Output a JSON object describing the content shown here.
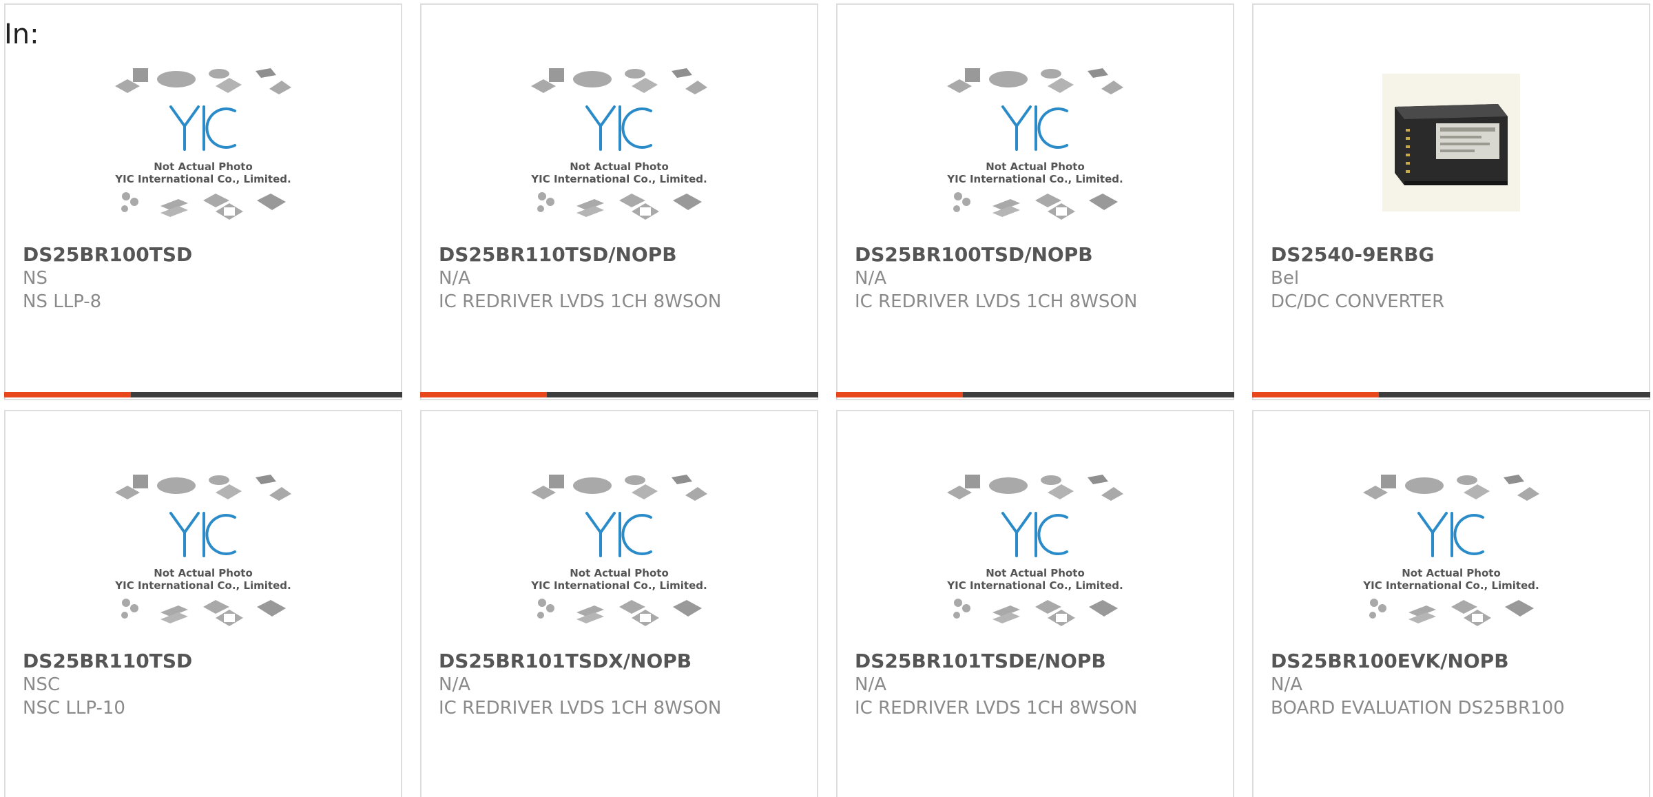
{
  "header": {
    "label": "In:"
  },
  "placeholder": {
    "logo_text": "YIC",
    "line1": "Not Actual Photo",
    "line2": "YIC International Co., Limited."
  },
  "colors": {
    "accent": "#e8461b",
    "bar": "#3d3d3d",
    "logo_blue": "#2a8bc8"
  },
  "products": [
    {
      "part": "DS25BR100TSD",
      "manufacturer": "NS",
      "description": "NS LLP-8",
      "image": "placeholder"
    },
    {
      "part": "DS25BR110TSD/NOPB",
      "manufacturer": "N/A",
      "description": "IC REDRIVER LVDS 1CH 8WSON",
      "image": "placeholder"
    },
    {
      "part": "DS25BR100TSD/NOPB",
      "manufacturer": "N/A",
      "description": "IC REDRIVER LVDS 1CH 8WSON",
      "image": "placeholder"
    },
    {
      "part": "DS2540-9ERBG",
      "manufacturer": "Bel",
      "description": "DC/DC CONVERTER",
      "image": "product-photo"
    },
    {
      "part": "DS25BR110TSD",
      "manufacturer": "NSC",
      "description": "NSC LLP-10",
      "image": "placeholder"
    },
    {
      "part": "DS25BR101TSDX/NOPB",
      "manufacturer": "N/A",
      "description": "IC REDRIVER LVDS 1CH 8WSON",
      "image": "placeholder"
    },
    {
      "part": "DS25BR101TSDE/NOPB",
      "manufacturer": "N/A",
      "description": "IC REDRIVER LVDS 1CH 8WSON",
      "image": "placeholder"
    },
    {
      "part": "DS25BR100EVK/NOPB",
      "manufacturer": "N/A",
      "description": "BOARD EVALUATION DS25BR100",
      "image": "placeholder"
    }
  ]
}
